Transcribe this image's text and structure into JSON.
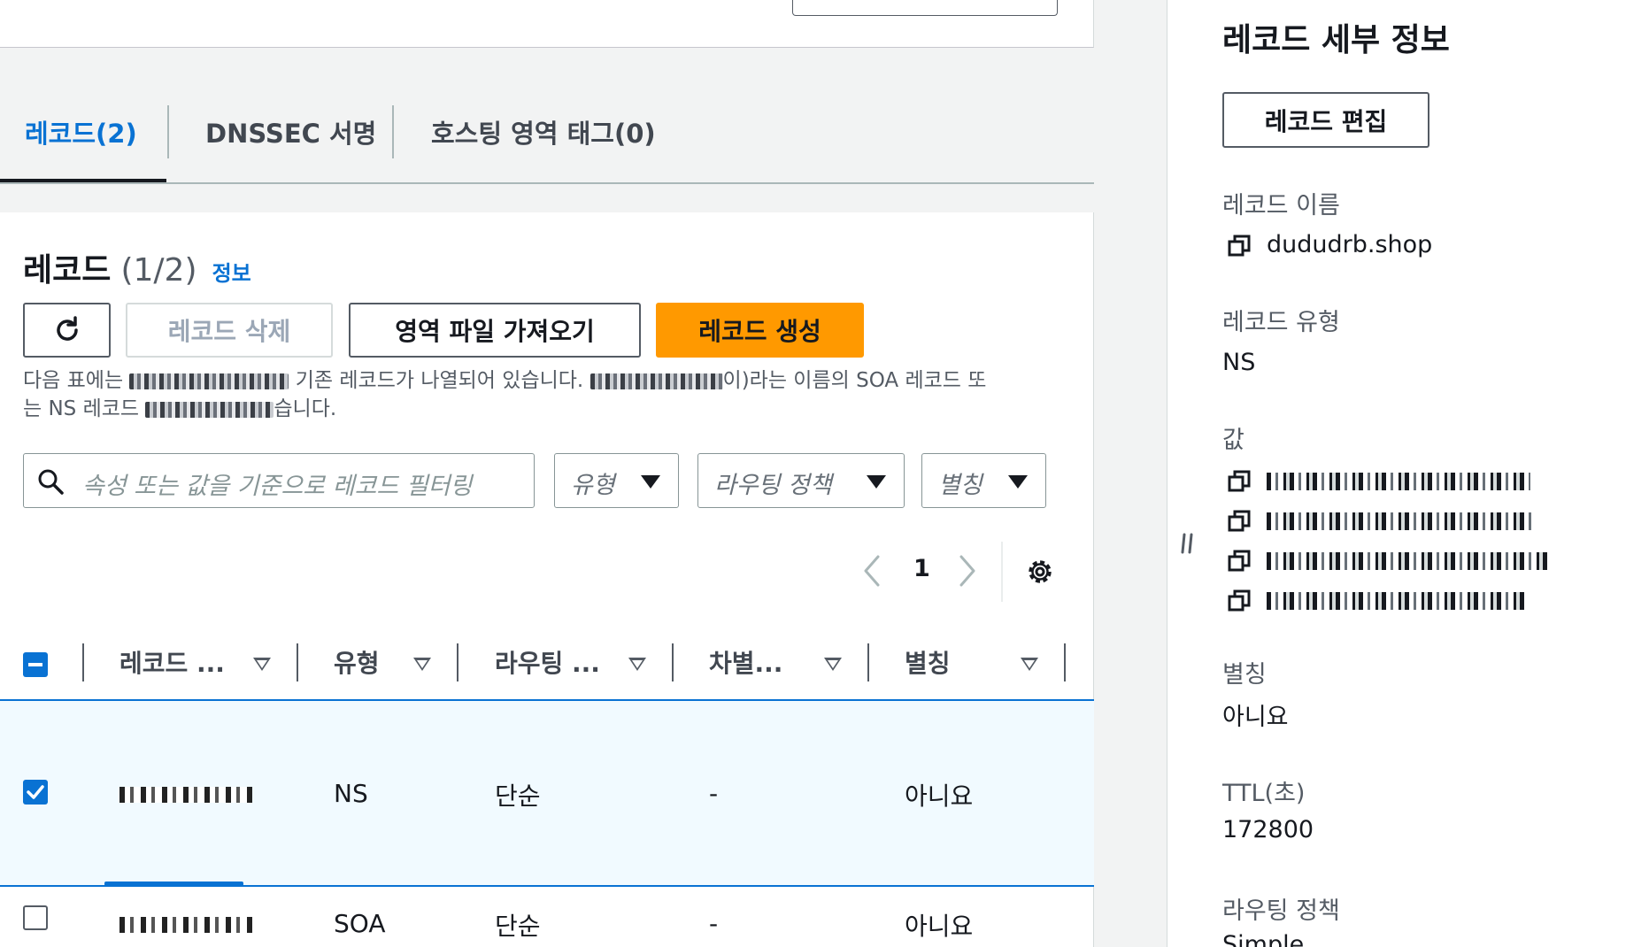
{
  "tabs": [
    {
      "label": "레코드(2)",
      "active": true
    },
    {
      "label": "DNSSEC 서명",
      "active": false
    },
    {
      "label": "호스팅 영역 태그(0)",
      "active": false
    }
  ],
  "records": {
    "title": "레코드",
    "count": "(1/2)",
    "info_link": "정보",
    "buttons": {
      "refresh_icon": "refresh-icon",
      "delete": "레코드 삭제",
      "import": "영역 파일 가져오기",
      "create": "레코드 생성"
    },
    "description": {
      "part1": "다음 표에는",
      "part2": "기존 레코드가 나열되어 있습니다.",
      "part3": "이)라는 이름의 SOA 레코드 또",
      "part4": "는 NS 레코드",
      "part5": "습니다."
    },
    "filter": {
      "placeholder": "속성 또는 값을 기준으로 레코드 필터링",
      "type_label": "유형",
      "routing_label": "라우팅 정책",
      "alias_label": "별칭"
    },
    "pagination": {
      "current": "1"
    },
    "columns": [
      "레코드 ...",
      "유형",
      "라우팅 ...",
      "차별...",
      "별칭"
    ],
    "rows": [
      {
        "type": "NS",
        "routing": "단순",
        "differentiator": "-",
        "alias": "아니요",
        "selected": true
      },
      {
        "type": "SOA",
        "routing": "단순",
        "differentiator": "-",
        "alias": "아니요",
        "selected": false
      }
    ]
  },
  "panel": {
    "title": "레코드 세부 정보",
    "edit_button": "레코드 편집",
    "record_name_label": "레코드 이름",
    "record_name_value": "dududrb.shop",
    "record_type_label": "레코드 유형",
    "record_type_value": "NS",
    "value_label": "값",
    "alias_label": "별칭",
    "alias_value": "아니요",
    "ttl_label": "TTL(초)",
    "ttl_value": "172800",
    "routing_label": "라우팅 정책",
    "routing_value": "Simple"
  },
  "colors": {
    "accent": "#0972d3",
    "primary_button": "#ff9900",
    "selected_row": "#f1faff"
  }
}
